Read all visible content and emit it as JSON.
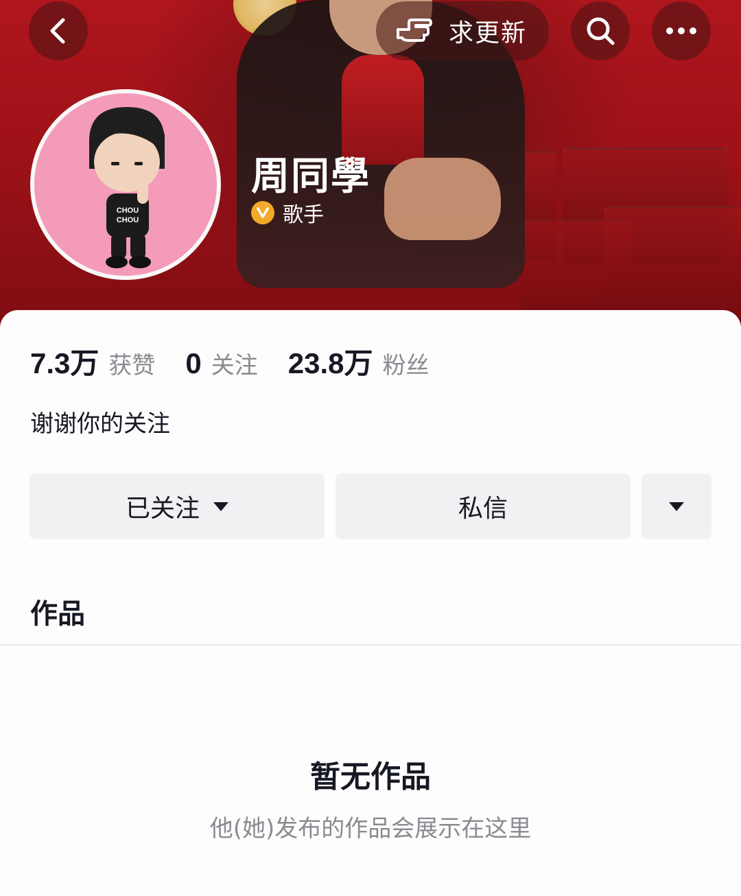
{
  "header": {
    "update_label": "求更新",
    "back_icon": "chevron-left-icon",
    "hand_icon": "pointing-hand-icon",
    "search_icon": "search-icon",
    "more_icon": "more-dots-icon"
  },
  "profile": {
    "name": "周同學",
    "role": "歌手",
    "verified_badge": "V",
    "avatar_shirt_text": "CHOU CHOU",
    "bio": "谢谢你的关注"
  },
  "stats": [
    {
      "value": "7.3万",
      "label": "获赞"
    },
    {
      "value": "0",
      "label": "关注"
    },
    {
      "value": "23.8万",
      "label": "粉丝"
    }
  ],
  "actions": {
    "follow_label": "已关注",
    "message_label": "私信"
  },
  "tabs": {
    "works_label": "作品"
  },
  "empty_state": {
    "title": "暂无作品",
    "subtitle": "他(她)发布的作品会展示在这里"
  },
  "colors": {
    "cover": "#a3141a",
    "button_bg": "#f1f1f3",
    "text_primary": "#161823",
    "text_secondary": "#8a8b91",
    "verified": "#f4a92a",
    "avatar_bg": "#f39bb8"
  }
}
